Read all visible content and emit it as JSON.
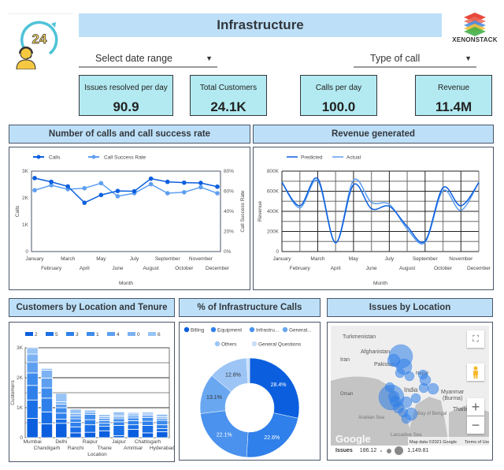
{
  "header": {
    "title": "Infrastructure",
    "brand": "XENONSTACK",
    "logo_left_icon": "24-hour-support-icon",
    "logo_right_icon": "xenonstack-stack-icon"
  },
  "filters": {
    "date_range": {
      "label": "Select date range",
      "icon": "dropdown-arrow-icon"
    },
    "call_type": {
      "label": "Type of call",
      "icon": "dropdown-arrow-icon"
    }
  },
  "kpis": [
    {
      "label": "Issues resolved per day",
      "value": "90.9"
    },
    {
      "label": "Total Customers",
      "value": "24.1K"
    },
    {
      "label": "Calls per day",
      "value": "100.0"
    },
    {
      "label": "Revenue",
      "value": "11.4M"
    }
  ],
  "sections": {
    "calls": "Number of calls and call success rate",
    "revenue": "Revenue generated",
    "customers": "Customers by Location and Tenure",
    "infra_calls": "% of Infrastructure Calls",
    "issues": "Issues by Location"
  },
  "colors": {
    "title_bg": "#bde0f8",
    "kpi_bg": "#b3eaf1",
    "primary_blue": "#0b5fde",
    "light_blue": "#5e9ff0"
  },
  "chart_data": [
    {
      "id": "calls",
      "type": "line",
      "x": [
        "January",
        "February",
        "March",
        "April",
        "May",
        "June",
        "July",
        "August",
        "September",
        "October",
        "November",
        "December"
      ],
      "series": [
        {
          "name": "Calls",
          "axis": "left",
          "color": "#0b5fde",
          "values": [
            2740,
            2600,
            2430,
            1820,
            2110,
            2260,
            2250,
            2720,
            2600,
            2570,
            2560,
            2420
          ]
        },
        {
          "name": "Call Success Rate",
          "axis": "right",
          "color": "#5e9ff0",
          "values": [
            61,
            66,
            62,
            63,
            68,
            55,
            58,
            67,
            58,
            59,
            64,
            58
          ]
        }
      ],
      "xlabel": "Month",
      "ylabel": "Calls",
      "ylabel_right": "Call Success Rate",
      "ylim": [
        0,
        3000
      ],
      "ylim_right": [
        0,
        80
      ],
      "yticks": [
        "0",
        "1K",
        "2K",
        "3K"
      ],
      "yticks_right": [
        "0%",
        "20%",
        "40%",
        "60%",
        "80%"
      ],
      "legend": "top-left",
      "grid": false
    },
    {
      "id": "revenue",
      "type": "line",
      "x": [
        "January",
        "February",
        "March",
        "April",
        "May",
        "June",
        "July",
        "August",
        "September",
        "October",
        "November",
        "December"
      ],
      "series": [
        {
          "name": "Predicted",
          "color": "#0b5fde",
          "values": [
            690000,
            455000,
            725000,
            87000,
            665000,
            427000,
            450000,
            250000,
            105000,
            635000,
            455000,
            685000
          ]
        },
        {
          "name": "Actual",
          "color": "#5e9ff0",
          "values": [
            690000,
            435000,
            705000,
            87000,
            710000,
            490000,
            470000,
            225000,
            92000,
            605000,
            410000,
            690000
          ]
        }
      ],
      "xlabel": "Month",
      "ylabel": "Revenue",
      "ylim": [
        0,
        800000
      ],
      "yticks": [
        "0",
        "200K",
        "400K",
        "600K",
        "800K"
      ],
      "legend": "top-left",
      "grid": true,
      "smooth": true
    },
    {
      "id": "customers",
      "type": "bar",
      "stacked": true,
      "categories": [
        "Mumbai",
        "Chandigarh",
        "Delhi",
        "Ranchi",
        "Raipur",
        "Thane",
        "Jaipur",
        "Amritsar",
        "Chattisgarh",
        "Hyderabad"
      ],
      "series": [
        {
          "name": "2",
          "color": "#0b5fde",
          "values": [
            646,
            460,
            480,
            160,
            180,
            230,
            70,
            280,
            160,
            200
          ]
        },
        {
          "name": "5",
          "color": "#1a6fe6",
          "values": [
            611,
            400,
            140,
            200,
            250,
            150,
            340,
            150,
            250,
            100
          ]
        },
        {
          "name": "3",
          "color": "#2f80ea",
          "values": [
            487,
            460,
            200,
            150,
            170,
            100,
            120,
            140,
            140,
            130
          ]
        },
        {
          "name": "1",
          "color": "#3d8bec",
          "values": [
            416,
            340,
            180,
            120,
            180,
            90,
            100,
            90,
            120,
            150
          ]
        },
        {
          "name": "4",
          "color": "#5e9ff0",
          "values": [
            363,
            330,
            120,
            100,
            60,
            70,
            60,
            70,
            70,
            70
          ]
        },
        {
          "name": "0",
          "color": "#7cb2f3",
          "values": [
            265,
            260,
            80,
            80,
            0,
            60,
            50,
            60,
            50,
            50
          ]
        },
        {
          "name": "6",
          "color": "#98c3f5",
          "values": [
            212,
            60,
            280,
            140,
            80,
            70,
            120,
            50,
            60,
            80
          ]
        }
      ],
      "xlabel": "Location",
      "ylabel": "Customers",
      "ylim": [
        0,
        3000
      ],
      "yticks": [
        "0",
        "1K",
        "2K",
        "3K"
      ],
      "legend": "top",
      "grid": true
    },
    {
      "id": "infra_calls",
      "type": "pie",
      "donut": true,
      "labels": [
        "Billing",
        "Equipment",
        "Infrastru...",
        "General...",
        "Others",
        "General Questions"
      ],
      "values": [
        28.4,
        22.6,
        22.1,
        13.1,
        12.8,
        1.0
      ],
      "value_labels": [
        "28.4%",
        "22.6%",
        "22.1%",
        "13.1%",
        "12.8%",
        ""
      ],
      "colors": [
        "#0b5fde",
        "#2f80ea",
        "#4a92ee",
        "#6aa7f1",
        "#9cc5f6",
        "#c7ddf9"
      ],
      "legend": "top"
    }
  ],
  "map": {
    "labels": [
      "Turkmenistan",
      "Afghanistan",
      "Iran",
      "Pakistan",
      "Nepal",
      "India",
      "Oman",
      "Myanmar (Burma)",
      "Thailar",
      "Arabian Sea",
      "Bay of Bengal",
      "Laccadive Sea",
      "Ch"
    ],
    "attribution": "Map data ©2021 Google",
    "terms": "Terms of Use",
    "google": "Google",
    "legend_label": "Issues",
    "legend_min": "186.12",
    "legend_max": "1,149.81",
    "controls": {
      "fullscreen": "fullscreen-icon",
      "pegman": "street-view-pegman-icon",
      "zoom_in": "+",
      "zoom_out": "−"
    }
  }
}
